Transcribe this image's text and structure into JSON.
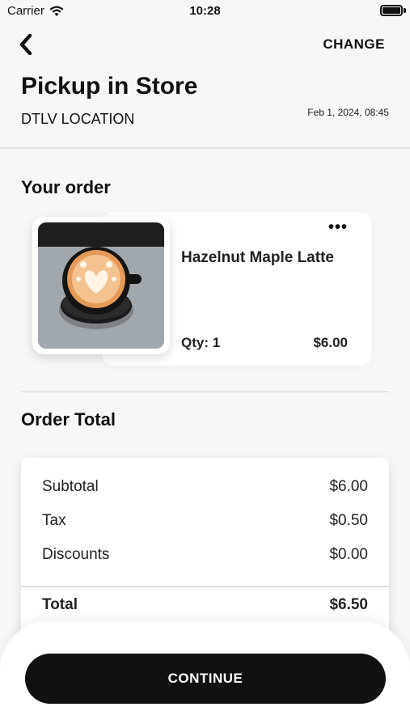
{
  "status": {
    "carrier": "Carrier",
    "time": "10:28"
  },
  "header": {
    "change_label": "CHANGE",
    "title": "Pickup in Store",
    "location": "DTLV LOCATION",
    "datetime": "Feb 1, 2024, 08:45"
  },
  "order": {
    "title": "Your order",
    "item": {
      "name": "Hazelnut Maple Latte",
      "qty": "Qty: 1",
      "price": "$6.00",
      "more": "•••"
    }
  },
  "totals": {
    "title": "Order Total",
    "subtotal_label": "Subtotal",
    "subtotal_value": "$6.00",
    "tax_label": "Tax",
    "tax_value": "$0.50",
    "discounts_label": "Discounts",
    "discounts_value": "$0.00",
    "total_label": "Total",
    "total_value": "$6.50"
  },
  "continue_label": "CONTINUE",
  "icons": {
    "back": "chevron-left-icon",
    "wifi": "wifi-icon",
    "battery": "battery-icon",
    "more": "more-dots-icon"
  }
}
